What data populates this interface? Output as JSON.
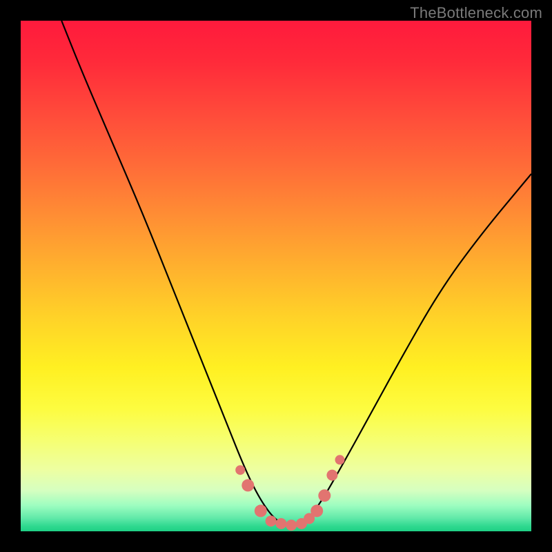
{
  "watermark": "TheBottleneck.com",
  "chart_data": {
    "type": "line",
    "title": "",
    "xlabel": "",
    "ylabel": "",
    "xlim": [
      0,
      100
    ],
    "ylim": [
      0,
      100
    ],
    "series": [
      {
        "name": "bottleneck-curve",
        "x": [
          8,
          12,
          18,
          24,
          30,
          36,
          40,
          44,
          47,
          50,
          53,
          56,
          59,
          63,
          68,
          74,
          82,
          90,
          100
        ],
        "values": [
          100,
          90,
          76,
          62,
          47,
          32,
          22,
          12,
          6,
          2,
          1,
          2,
          6,
          13,
          22,
          33,
          47,
          58,
          70
        ]
      }
    ],
    "markers": {
      "name": "highlighted-points",
      "x": [
        43,
        44.5,
        47,
        49,
        51,
        53,
        55,
        56.5,
        58,
        59.5,
        61,
        62.5
      ],
      "values": [
        12,
        9,
        4,
        2,
        1.5,
        1.2,
        1.5,
        2.5,
        4,
        7,
        11,
        14
      ],
      "r": [
        7,
        9,
        9,
        8,
        8,
        8,
        8,
        8,
        9,
        9,
        8,
        7
      ]
    },
    "gradient_stops": [
      {
        "pos": 0,
        "color": "#ff1a3c"
      },
      {
        "pos": 50,
        "color": "#ffb02e"
      },
      {
        "pos": 75,
        "color": "#fdfc40"
      },
      {
        "pos": 100,
        "color": "#1fd085"
      }
    ]
  }
}
